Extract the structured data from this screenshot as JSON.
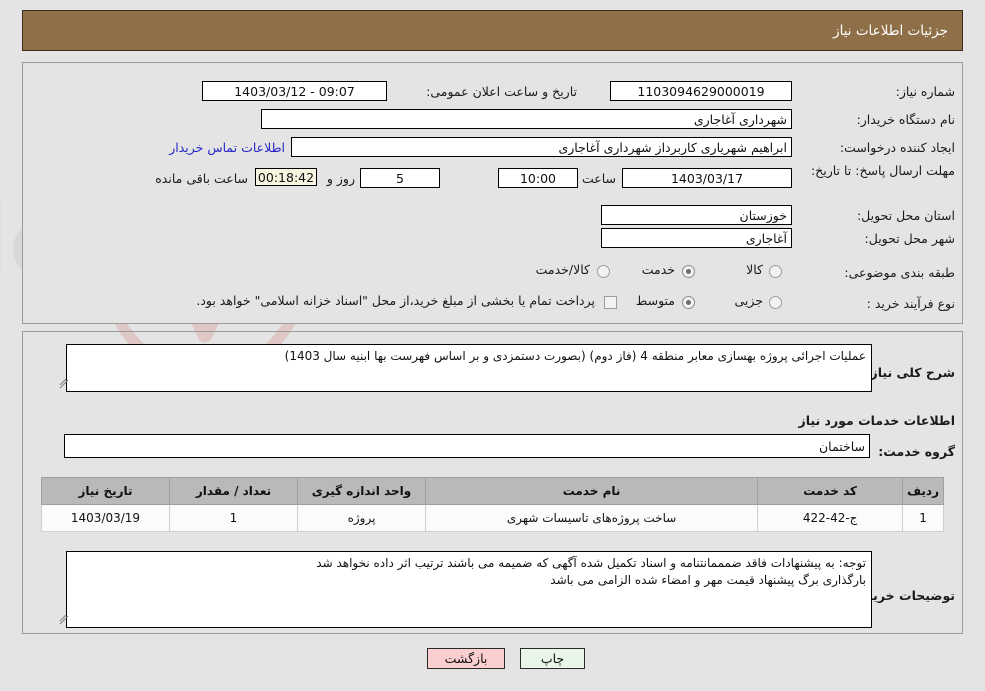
{
  "header": {
    "title": "جزئیات اطلاعات نیاز"
  },
  "form": {
    "need_number_label": "شماره نیاز:",
    "need_number_value": "1103094629000019",
    "buyer_org_label": "نام دستگاه خریدار:",
    "buyer_org_value": "شهرداری آغاجاری",
    "creator_label": "ایجاد کننده درخواست:",
    "creator_value": "ابراهیم شهریاری کاربرداز شهرداری آغاجاری",
    "deadline_label": "مهلت ارسال پاسخ: تا تاریخ:",
    "deadline_date": "1403/03/17",
    "hour_label": "ساعت",
    "deadline_time": "10:00",
    "days_remaining": "5",
    "days_and_label": "روز و",
    "countdown": "00:18:42",
    "remaining_label": "ساعت باقی مانده",
    "announce_label": "تاریخ و ساعت اعلان عمومی:",
    "announce_value": "09:07 - 1403/03/12",
    "contact_link": "اطلاعات تماس خریدار",
    "province_label": "استان محل تحویل:",
    "province_value": "خوزستان",
    "city_label": "شهر محل تحویل:",
    "city_value": "آغاجاری",
    "category_label": "طبقه بندی موضوعی:",
    "category_options": [
      "کالا",
      "خدمت",
      "کالا/خدمت"
    ],
    "category_selected": "خدمت",
    "process_label": "نوع فرآیند خرید :",
    "process_options": [
      "جزیی",
      "متوسط"
    ],
    "process_selected": "متوسط",
    "payment_note": "پرداخت تمام یا بخشی از مبلغ خرید،از محل \"اسناد خزانه اسلامی\" خواهد بود."
  },
  "description": {
    "label": "شرح کلی نیاز:",
    "value": "عملیات اجرائی پروژه بهسازی معابر منطقه 4 (فاز دوم) (بصورت دستمزدی و بر اساس فهرست بها ابنیه سال 1403)"
  },
  "services": {
    "section_title": "اطلاعات خدمات مورد نیاز",
    "group_label": "گروه خدمت:",
    "group_value": "ساختمان",
    "columns": [
      "ردیف",
      "کد خدمت",
      "نام خدمت",
      "واحد اندازه گیری",
      "تعداد / مقدار",
      "تاریخ نیاز"
    ],
    "rows": [
      {
        "row_no": "1",
        "service_code": "ج-42-422",
        "service_name": "ساخت پروژه‌های تاسیسات شهری",
        "unit": "پروژه",
        "quantity": "1",
        "need_date": "1403/03/19"
      }
    ]
  },
  "buyer_notes": {
    "label": "توضیحات خریدار:",
    "value": "توجه: به پیشنهادات فاقد ضمممانتنامه و اسناد تکمیل شده آگهی که ضمیمه می باشند ترتیب اثر داده نخواهد شد\nبارگذاری برگ پیشنهاد قیمت مهر و امضاء شده الزامی می باشد"
  },
  "buttons": {
    "print": "چاپ",
    "back": "بازگشت"
  },
  "colors": {
    "header_bg": "#8f6f47",
    "page_bg": "#e4e4e4",
    "link": "#2626c8",
    "table_header_bg": "#b9b9b9",
    "print_btn_bg": "#e7f6e7",
    "back_btn_bg": "#fbcfcf",
    "countdown_bg": "#f7f4e0"
  },
  "watermark": {
    "text": "AriaTender.net"
  }
}
